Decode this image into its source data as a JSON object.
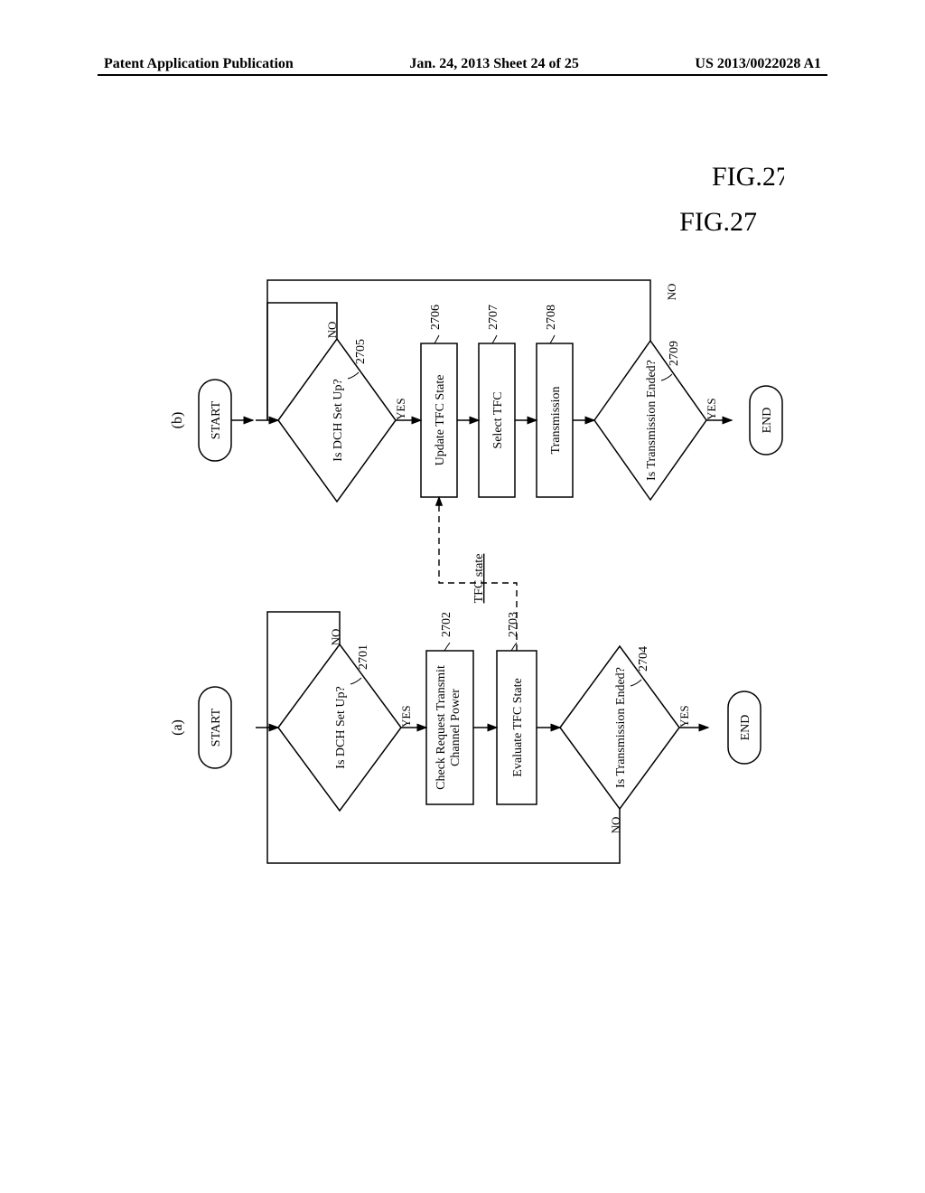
{
  "header": {
    "left": "Patent Application Publication",
    "center": "Jan. 24, 2013   Sheet 24 of 25",
    "right": "US 2013/0022028 A1"
  },
  "figure": {
    "label": "FIG.27",
    "panel_a": "(a)",
    "panel_b": "(b)",
    "start": "START",
    "end": "END",
    "yes": "YES",
    "no": "NO",
    "tfc_state_link": "TFC state",
    "a": {
      "d2701": {
        "ref": "2701",
        "text": "Is DCH Set Up?"
      },
      "p2702": {
        "ref": "2702",
        "text_line1": "Check Request Transmit",
        "text_line2": "Channel Power"
      },
      "p2703": {
        "ref": "2703",
        "text": "Evaluate TFC State"
      },
      "d2704": {
        "ref": "2704",
        "text": "Is Transmission Ended?"
      }
    },
    "b": {
      "d2705": {
        "ref": "2705",
        "text": "Is DCH Set Up?"
      },
      "p2706": {
        "ref": "2706",
        "text": "Update TFC State"
      },
      "p2707": {
        "ref": "2707",
        "text": "Select TFC"
      },
      "p2708": {
        "ref": "2708",
        "text": "Transmission"
      },
      "d2709": {
        "ref": "2709",
        "text": "Is Transmission Ended?"
      }
    }
  },
  "chart_data": {
    "type": "diagram",
    "description": "Two side-by-side flowcharts (a) and (b), rotated 90 degrees (reading bottom-to-top). Both start at START terminal, flow through a 'Is DCH Set Up?' decision diamond, through process boxes, to a 'Is Transmission Ended?' decision, and end at END terminal on YES. NO branches loop back to the top decision. A dashed line labeled 'TFC state' connects the Evaluate TFC State box (2703) in (a) to the Update TFC State box (2706) in (b).",
    "flowchart_a": {
      "nodes": [
        {
          "id": "start_a",
          "type": "terminal",
          "label": "START"
        },
        {
          "id": "2701",
          "type": "decision",
          "label": "Is DCH Set Up?"
        },
        {
          "id": "2702",
          "type": "process",
          "label": "Check Request Transmit Channel Power"
        },
        {
          "id": "2703",
          "type": "process",
          "label": "Evaluate TFC State"
        },
        {
          "id": "2704",
          "type": "decision",
          "label": "Is Transmission Ended?"
        },
        {
          "id": "end_a",
          "type": "terminal",
          "label": "END"
        }
      ],
      "edges": [
        {
          "from": "start_a",
          "to": "2701"
        },
        {
          "from": "2701",
          "to": "2702",
          "label": "YES"
        },
        {
          "from": "2701",
          "to": "2701",
          "label": "NO",
          "loop": true
        },
        {
          "from": "2702",
          "to": "2703"
        },
        {
          "from": "2703",
          "to": "2704"
        },
        {
          "from": "2704",
          "to": "end_a",
          "label": "YES"
        },
        {
          "from": "2704",
          "to": "2701",
          "label": "NO",
          "loop": true
        }
      ]
    },
    "flowchart_b": {
      "nodes": [
        {
          "id": "start_b",
          "type": "terminal",
          "label": "START"
        },
        {
          "id": "2705",
          "type": "decision",
          "label": "Is DCH Set Up?"
        },
        {
          "id": "2706",
          "type": "process",
          "label": "Update TFC State"
        },
        {
          "id": "2707",
          "type": "process",
          "label": "Select TFC"
        },
        {
          "id": "2708",
          "type": "process",
          "label": "Transmission"
        },
        {
          "id": "2709",
          "type": "decision",
          "label": "Is Transmission Ended?"
        },
        {
          "id": "end_b",
          "type": "terminal",
          "label": "END"
        }
      ],
      "edges": [
        {
          "from": "start_b",
          "to": "2705"
        },
        {
          "from": "2705",
          "to": "2706",
          "label": "YES"
        },
        {
          "from": "2705",
          "to": "2705",
          "label": "NO",
          "loop": true
        },
        {
          "from": "2706",
          "to": "2707"
        },
        {
          "from": "2707",
          "to": "2708"
        },
        {
          "from": "2708",
          "to": "2709"
        },
        {
          "from": "2709",
          "to": "end_b",
          "label": "YES"
        },
        {
          "from": "2709",
          "to": "2705",
          "label": "NO",
          "loop": true
        }
      ]
    },
    "cross_link": {
      "from": "2703",
      "to": "2706",
      "label": "TFC state",
      "style": "dashed"
    }
  }
}
